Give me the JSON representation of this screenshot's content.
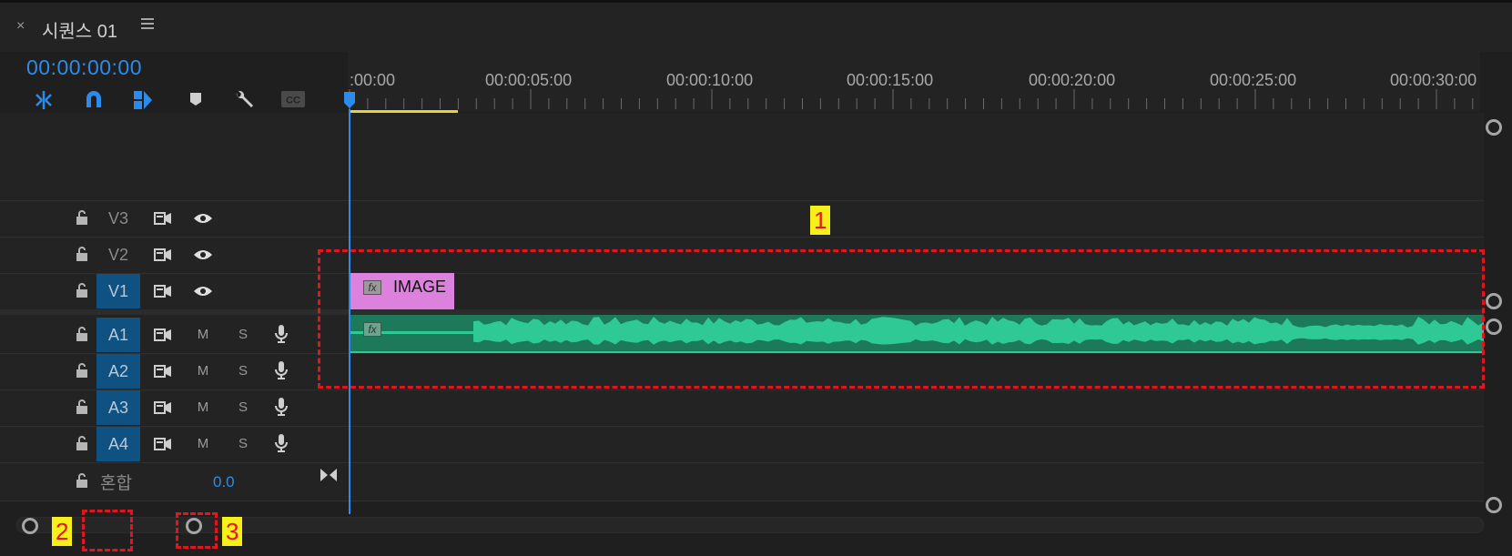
{
  "panel": {
    "close_glyph": "×",
    "title": "시퀀스 01",
    "menu_icon": "hamburger-menu-icon",
    "timecode": "00:00:00:00"
  },
  "toolbar": {
    "icons": [
      "snap-insert-icon",
      "magnet-icon",
      "linked-selection-icon",
      "marker-icon",
      "wrench-icon",
      "captions-icon"
    ],
    "captions_label": "CC"
  },
  "ruler": {
    "ticks": [
      ":00:00",
      "00:00:05:00",
      "00:00:10:00",
      "00:00:15:00",
      "00:00:20:00",
      "00:00:25:00",
      "00:00:30:00"
    ]
  },
  "tracks": {
    "video": [
      {
        "label": "V3",
        "targeted": false
      },
      {
        "label": "V2",
        "targeted": false
      },
      {
        "label": "V1",
        "targeted": true
      }
    ],
    "audio": [
      {
        "label": "A1",
        "targeted": true,
        "mute": "M",
        "solo": "S"
      },
      {
        "label": "A2",
        "targeted": true,
        "mute": "M",
        "solo": "S"
      },
      {
        "label": "A3",
        "targeted": true,
        "mute": "M",
        "solo": "S"
      },
      {
        "label": "A4",
        "targeted": true,
        "mute": "M",
        "solo": "S"
      }
    ],
    "mix": {
      "label": "혼합",
      "value": "0.0"
    }
  },
  "clips": {
    "video": {
      "name": "IMAGE",
      "fx": "fx",
      "color": "#dc82dc"
    },
    "audio": {
      "fx": "fx",
      "color": "#2ec995"
    }
  },
  "annotations": {
    "tag1": "1",
    "tag2": "2",
    "tag3": "3",
    "color": "#e2141d"
  }
}
